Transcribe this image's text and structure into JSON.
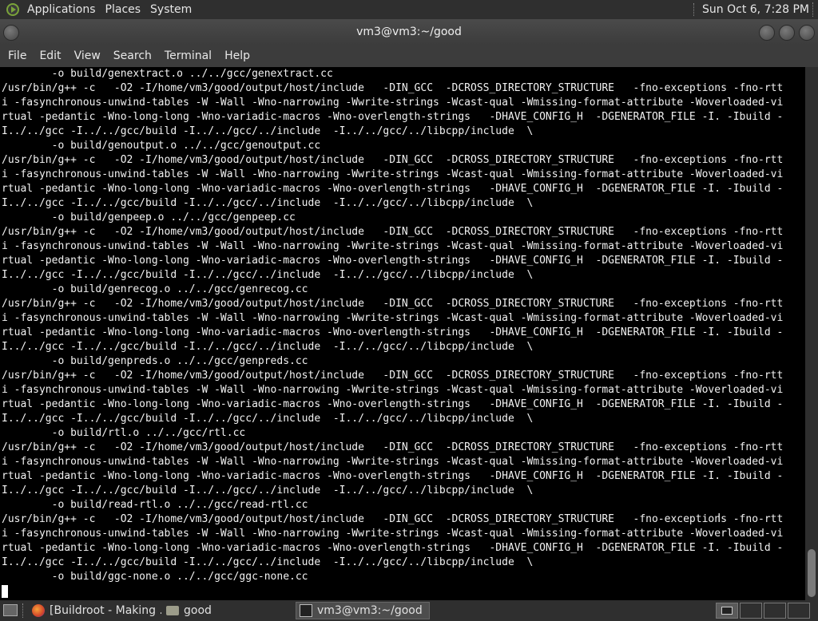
{
  "top_panel": {
    "menus": [
      "Applications",
      "Places",
      "System"
    ],
    "clock": "Sun Oct  6,  7:28 PM"
  },
  "window": {
    "title": "vm3@vm3:~/good"
  },
  "menubar": [
    "File",
    "Edit",
    "View",
    "Search",
    "Terminal",
    "Help"
  ],
  "terminal": {
    "lines": [
      "        -o build/genextract.o ../../gcc/genextract.cc",
      "/usr/bin/g++ -c   -O2 -I/home/vm3/good/output/host/include   -DIN_GCC  -DCROSS_DIRECTORY_STRUCTURE   -fno-exceptions -fno-rtt",
      "i -fasynchronous-unwind-tables -W -Wall -Wno-narrowing -Wwrite-strings -Wcast-qual -Wmissing-format-attribute -Woverloaded-vi",
      "rtual -pedantic -Wno-long-long -Wno-variadic-macros -Wno-overlength-strings   -DHAVE_CONFIG_H  -DGENERATOR_FILE -I. -Ibuild -",
      "I../../gcc -I../../gcc/build -I../../gcc/../include  -I../../gcc/../libcpp/include  \\",
      "        -o build/genoutput.o ../../gcc/genoutput.cc",
      "/usr/bin/g++ -c   -O2 -I/home/vm3/good/output/host/include   -DIN_GCC  -DCROSS_DIRECTORY_STRUCTURE   -fno-exceptions -fno-rtt",
      "i -fasynchronous-unwind-tables -W -Wall -Wno-narrowing -Wwrite-strings -Wcast-qual -Wmissing-format-attribute -Woverloaded-vi",
      "rtual -pedantic -Wno-long-long -Wno-variadic-macros -Wno-overlength-strings   -DHAVE_CONFIG_H  -DGENERATOR_FILE -I. -Ibuild -",
      "I../../gcc -I../../gcc/build -I../../gcc/../include  -I../../gcc/../libcpp/include  \\",
      "        -o build/genpeep.o ../../gcc/genpeep.cc",
      "/usr/bin/g++ -c   -O2 -I/home/vm3/good/output/host/include   -DIN_GCC  -DCROSS_DIRECTORY_STRUCTURE   -fno-exceptions -fno-rtt",
      "i -fasynchronous-unwind-tables -W -Wall -Wno-narrowing -Wwrite-strings -Wcast-qual -Wmissing-format-attribute -Woverloaded-vi",
      "rtual -pedantic -Wno-long-long -Wno-variadic-macros -Wno-overlength-strings   -DHAVE_CONFIG_H  -DGENERATOR_FILE -I. -Ibuild -",
      "I../../gcc -I../../gcc/build -I../../gcc/../include  -I../../gcc/../libcpp/include  \\",
      "        -o build/genrecog.o ../../gcc/genrecog.cc",
      "/usr/bin/g++ -c   -O2 -I/home/vm3/good/output/host/include   -DIN_GCC  -DCROSS_DIRECTORY_STRUCTURE   -fno-exceptions -fno-rtt",
      "i -fasynchronous-unwind-tables -W -Wall -Wno-narrowing -Wwrite-strings -Wcast-qual -Wmissing-format-attribute -Woverloaded-vi",
      "rtual -pedantic -Wno-long-long -Wno-variadic-macros -Wno-overlength-strings   -DHAVE_CONFIG_H  -DGENERATOR_FILE -I. -Ibuild -",
      "I../../gcc -I../../gcc/build -I../../gcc/../include  -I../../gcc/../libcpp/include  \\",
      "        -o build/genpreds.o ../../gcc/genpreds.cc",
      "/usr/bin/g++ -c   -O2 -I/home/vm3/good/output/host/include   -DIN_GCC  -DCROSS_DIRECTORY_STRUCTURE   -fno-exceptions -fno-rtt",
      "i -fasynchronous-unwind-tables -W -Wall -Wno-narrowing -Wwrite-strings -Wcast-qual -Wmissing-format-attribute -Woverloaded-vi",
      "rtual -pedantic -Wno-long-long -Wno-variadic-macros -Wno-overlength-strings   -DHAVE_CONFIG_H  -DGENERATOR_FILE -I. -Ibuild -",
      "I../../gcc -I../../gcc/build -I../../gcc/../include  -I../../gcc/../libcpp/include  \\",
      "        -o build/rtl.o ../../gcc/rtl.cc",
      "/usr/bin/g++ -c   -O2 -I/home/vm3/good/output/host/include   -DIN_GCC  -DCROSS_DIRECTORY_STRUCTURE   -fno-exceptions -fno-rtt",
      "i -fasynchronous-unwind-tables -W -Wall -Wno-narrowing -Wwrite-strings -Wcast-qual -Wmissing-format-attribute -Woverloaded-vi",
      "rtual -pedantic -Wno-long-long -Wno-variadic-macros -Wno-overlength-strings   -DHAVE_CONFIG_H  -DGENERATOR_FILE -I. -Ibuild -",
      "I../../gcc -I../../gcc/build -I../../gcc/../include  -I../../gcc/../libcpp/include  \\",
      "        -o build/read-rtl.o ../../gcc/read-rtl.cc",
      "/usr/bin/g++ -c   -O2 -I/home/vm3/good/output/host/include   -DIN_GCC  -DCROSS_DIRECTORY_STRUCTURE   -fno-exceptions -fno-rtt",
      "i -fasynchronous-unwind-tables -W -Wall -Wno-narrowing -Wwrite-strings -Wcast-qual -Wmissing-format-attribute -Woverloaded-vi",
      "rtual -pedantic -Wno-long-long -Wno-variadic-macros -Wno-overlength-strings   -DHAVE_CONFIG_H  -DGENERATOR_FILE -I. -Ibuild -",
      "I../../gcc -I../../gcc/build -I../../gcc/../include  -I../../gcc/../libcpp/include  \\",
      "        -o build/ggc-none.o ../../gcc/ggc-none.cc",
      ""
    ]
  },
  "taskbar": {
    "tasks": [
      {
        "label": "[Buildroot - Making ...",
        "icon": "firefox-icon"
      },
      {
        "label": "good",
        "icon": "folder-icon"
      },
      {
        "label": "vm3@vm3:~/good",
        "icon": "terminal-icon"
      }
    ]
  },
  "colors": {
    "terminal_bg": "#000000",
    "terminal_fg": "#f2f2f2",
    "panel_bg": "#2f2f2f"
  }
}
